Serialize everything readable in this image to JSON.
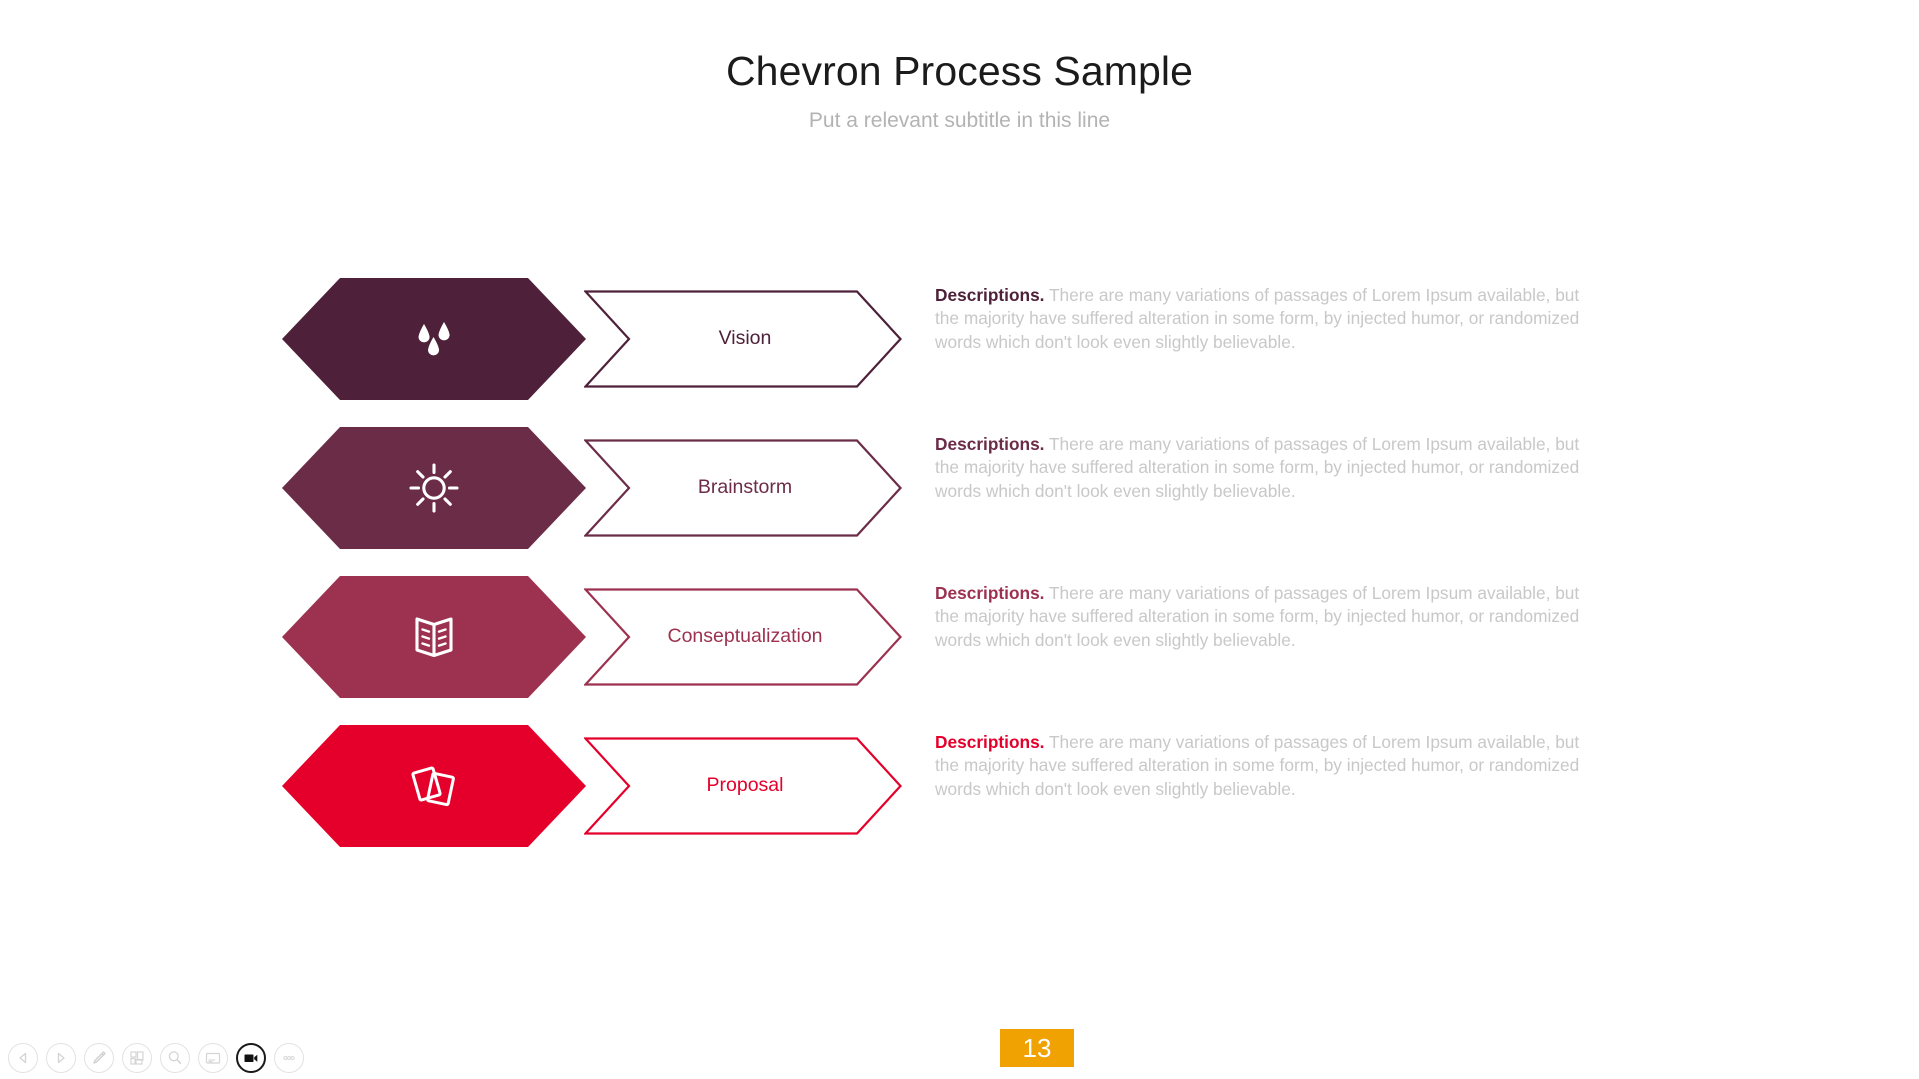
{
  "header": {
    "title": "Chevron Process Sample",
    "subtitle": "Put a relevant subtitle in this line"
  },
  "colors": {
    "step1": "#4e2039",
    "step2": "#6b2c48",
    "step3": "#9c3250",
    "step4": "#e4002b",
    "badge": "#f0a202",
    "body_text": "#c8c8c8",
    "title_text": "#1b1b1b",
    "subtitle_text": "#b3b3b3"
  },
  "steps": [
    {
      "label": "Vision",
      "icon": "water-drops-icon",
      "color": "#4e2039",
      "desc_lead": "Descriptions.",
      "desc_body": "There are many variations of passages of Lorem Ipsum available, but the majority have suffered alteration in some form, by injected humor, or randomized words which don't look even slightly believable."
    },
    {
      "label": "Brainstorm",
      "icon": "sun-icon",
      "color": "#6b2c48",
      "desc_lead": "Descriptions.",
      "desc_body": "There are many variations of passages of Lorem Ipsum available, but the majority have suffered alteration in some form, by injected humor, or randomized words which don't look even slightly believable."
    },
    {
      "label": "Conseptualization",
      "icon": "open-book-icon",
      "color": "#9c3250",
      "desc_lead": "Descriptions.",
      "desc_body": "There are many variations of passages of Lorem Ipsum available, but the majority have suffered alteration in some form, by injected humor, or randomized words which don't look even slightly believable."
    },
    {
      "label": "Proposal",
      "icon": "cards-icon",
      "color": "#e4002b",
      "desc_lead": "Descriptions.",
      "desc_body": "There are many variations of passages of Lorem Ipsum available, but the majority have suffered alteration in some form, by injected humor, or randomized words which don't look even slightly believable."
    }
  ],
  "footer": {
    "page_number": "13",
    "toolbar": [
      {
        "name": "previous-slide-button",
        "icon": "triangle-left-icon",
        "active": false
      },
      {
        "name": "next-slide-button",
        "icon": "triangle-right-icon",
        "active": false
      },
      {
        "name": "pen-tool-button",
        "icon": "pen-icon",
        "active": false
      },
      {
        "name": "slide-grid-button",
        "icon": "grid-icon",
        "active": false
      },
      {
        "name": "zoom-button",
        "icon": "magnifier-icon",
        "active": false
      },
      {
        "name": "presenter-notes-button",
        "icon": "notes-icon",
        "active": false
      },
      {
        "name": "video-button",
        "icon": "video-camera-icon",
        "active": true
      },
      {
        "name": "more-options-button",
        "icon": "ellipsis-icon",
        "active": false
      }
    ]
  }
}
